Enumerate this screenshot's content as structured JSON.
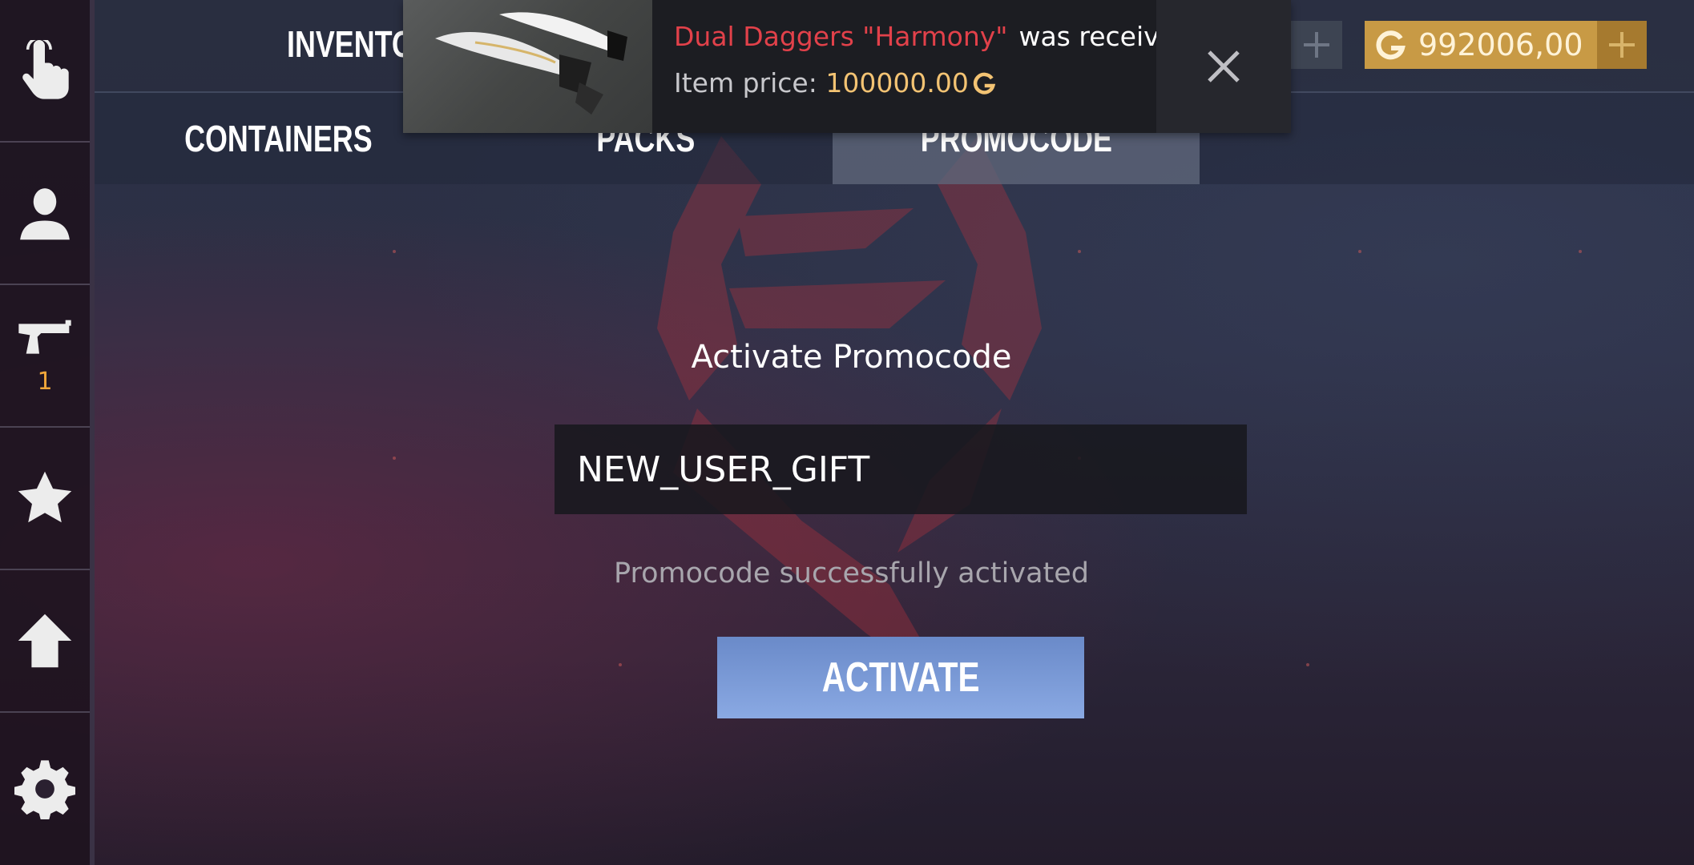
{
  "header": {
    "title": "INVENTORY"
  },
  "tabs": [
    {
      "label": "CONTAINERS",
      "active": false
    },
    {
      "label": "PACKS",
      "active": false
    },
    {
      "label": "PROMOCODE",
      "active": true
    }
  ],
  "sidebar": {
    "items": [
      {
        "icon": "hand-pointer-icon"
      },
      {
        "icon": "user-silhouette-icon"
      },
      {
        "icon": "pistol-icon",
        "badge": "1"
      },
      {
        "icon": "star-icon"
      },
      {
        "icon": "arrow-up-icon"
      },
      {
        "icon": "gear-icon"
      }
    ]
  },
  "notification": {
    "item_name": "Dual Daggers \"Harmony\"",
    "message": "was receiv...",
    "price_label": "Item price:",
    "price_value": "100000.00",
    "image_icon": "dual-daggers-icon",
    "close_icon": "close-icon"
  },
  "currency": {
    "gold_value": "992006,00",
    "gold_icon": "gold-g-icon"
  },
  "promo": {
    "title": "Activate Promocode",
    "code_value": "NEW_USER_GIFT",
    "status": "Promocode successfully activated",
    "button_label": "ACTIVATE"
  },
  "colors": {
    "item_name": "#e2414a",
    "price": "#f3c373",
    "gold_box": "#c89a45",
    "badge": "#f0a63a",
    "activate_button": "#7a9ad6"
  }
}
